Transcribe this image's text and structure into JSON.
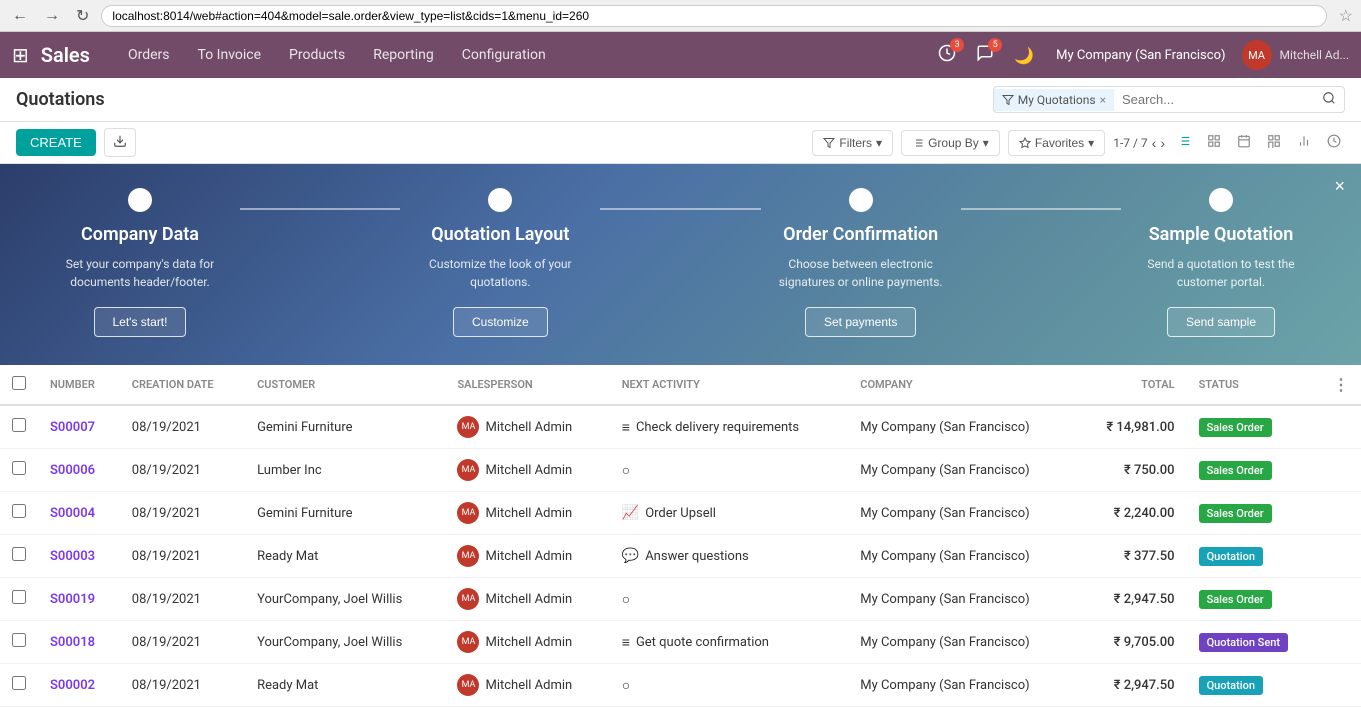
{
  "browser": {
    "back_label": "←",
    "forward_label": "→",
    "refresh_label": "↻",
    "url": "localhost:8014/web#action=404&model=sale.order&view_type=list&cids=1&menu_id=260",
    "star_icon": "☆"
  },
  "navbar": {
    "app_icon": "⊞",
    "title": "Sales",
    "links": [
      {
        "label": "Orders",
        "active": false
      },
      {
        "label": "To Invoice",
        "active": false
      },
      {
        "label": "Products",
        "active": false
      },
      {
        "label": "Reporting",
        "active": false
      },
      {
        "label": "Configuration",
        "active": false
      }
    ],
    "notif1_count": "3",
    "notif2_count": "5",
    "dark_mode_icon": "🌙",
    "company": "My Company (San Francisco)",
    "user_initials": "MA",
    "user_name": "Mitchell Ad..."
  },
  "page": {
    "title": "Quotations",
    "search_tag": "My Quotations",
    "search_placeholder": "Search..."
  },
  "toolbar": {
    "create_label": "CREATE",
    "download_icon": "⬇",
    "filter_label": "Filters",
    "filter_icon": "▾",
    "groupby_label": "Group By",
    "groupby_icon": "▾",
    "favorites_label": "Favorites",
    "favorites_icon": "▾",
    "pagination": "1-7 / 7",
    "prev_icon": "‹",
    "next_icon": "›"
  },
  "onboarding": {
    "close_icon": "×",
    "steps": [
      {
        "title": "Company Data",
        "desc": "Set your company's data for documents header/footer.",
        "btn_label": "Let's start!"
      },
      {
        "title": "Quotation Layout",
        "desc": "Customize the look of your quotations.",
        "btn_label": "Customize"
      },
      {
        "title": "Order Confirmation",
        "desc": "Choose between electronic signatures or online payments.",
        "btn_label": "Set payments"
      },
      {
        "title": "Sample Quotation",
        "desc": "Send a quotation to test the customer portal.",
        "btn_label": "Send sample"
      }
    ]
  },
  "table": {
    "columns": [
      "NUMBER",
      "CREATION DATE",
      "CUSTOMER",
      "SALESPERSON",
      "NEXT ACTIVITY",
      "COMPANY",
      "TOTAL",
      "STATUS"
    ],
    "rows": [
      {
        "number": "S00007",
        "creation_date": "08/19/2021",
        "customer": "Gemini Furniture",
        "salesperson": "Mitchell Admin",
        "salesperson_initials": "MA",
        "next_activity_icon": "≡",
        "next_activity": "Check delivery requirements",
        "company": "My Company (San Francisco)",
        "total": "₹ 14,981.00",
        "status": "Sales Order",
        "status_class": "status-sales-order"
      },
      {
        "number": "S00006",
        "creation_date": "08/19/2021",
        "customer": "Lumber Inc",
        "salesperson": "Mitchell Admin",
        "salesperson_initials": "MA",
        "next_activity_icon": "○",
        "next_activity": "",
        "company": "My Company (San Francisco)",
        "total": "₹ 750.00",
        "status": "Sales Order",
        "status_class": "status-sales-order"
      },
      {
        "number": "S00004",
        "creation_date": "08/19/2021",
        "customer": "Gemini Furniture",
        "salesperson": "Mitchell Admin",
        "salesperson_initials": "MA",
        "next_activity_icon": "📈",
        "next_activity": "Order Upsell",
        "company": "My Company (San Francisco)",
        "total": "₹ 2,240.00",
        "status": "Sales Order",
        "status_class": "status-sales-order"
      },
      {
        "number": "S00003",
        "creation_date": "08/19/2021",
        "customer": "Ready Mat",
        "salesperson": "Mitchell Admin",
        "salesperson_initials": "MA",
        "next_activity_icon": "💬",
        "next_activity": "Answer questions",
        "company": "My Company (San Francisco)",
        "total": "₹ 377.50",
        "status": "Quotation",
        "status_class": "status-quotation"
      },
      {
        "number": "S00019",
        "creation_date": "08/19/2021",
        "customer": "YourCompany, Joel Willis",
        "salesperson": "Mitchell Admin",
        "salesperson_initials": "MA",
        "next_activity_icon": "○",
        "next_activity": "",
        "company": "My Company (San Francisco)",
        "total": "₹ 2,947.50",
        "status": "Sales Order",
        "status_class": "status-sales-order"
      },
      {
        "number": "S00018",
        "creation_date": "08/19/2021",
        "customer": "YourCompany, Joel Willis",
        "salesperson": "Mitchell Admin",
        "salesperson_initials": "MA",
        "next_activity_icon": "≡",
        "next_activity": "Get quote confirmation",
        "company": "My Company (San Francisco)",
        "total": "₹ 9,705.00",
        "status": "Quotation Sent",
        "status_class": "status-quotation-sent"
      },
      {
        "number": "S00002",
        "creation_date": "08/19/2021",
        "customer": "Ready Mat",
        "salesperson": "Mitchell Admin",
        "salesperson_initials": "MA",
        "next_activity_icon": "○",
        "next_activity": "",
        "company": "My Company (San Francisco)",
        "total": "₹ 2,947.50",
        "status": "Quotation",
        "status_class": "status-quotation"
      }
    ]
  }
}
